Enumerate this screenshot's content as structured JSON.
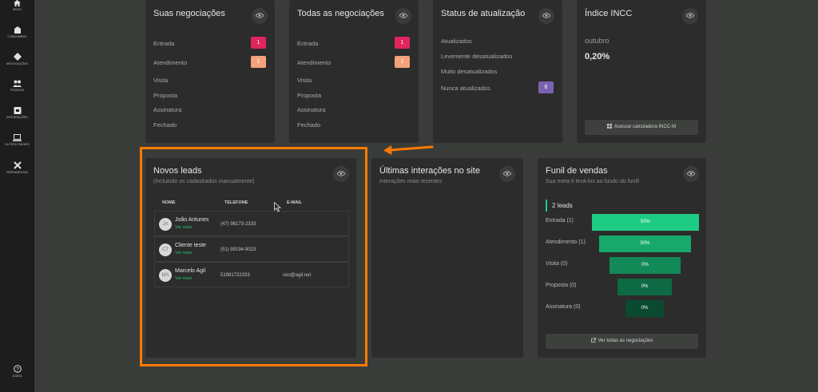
{
  "sidebar": {
    "items": [
      {
        "label": "Início",
        "icon": "home-icon"
      },
      {
        "label": "Condomínio",
        "icon": "building-icon"
      },
      {
        "label": "Negociações",
        "icon": "handshake-icon"
      },
      {
        "label": "Pessoas",
        "icon": "people-icon"
      },
      {
        "label": "Integrações",
        "icon": "integration-icon"
      },
      {
        "label": "Outros painéis",
        "icon": "laptop-icon"
      },
      {
        "label": "Ferramentas",
        "icon": "tools-icon"
      }
    ],
    "help_label": "Ajuda"
  },
  "suas_negociacoes": {
    "title": "Suas negociações",
    "rows": [
      {
        "label": "Entrada",
        "count": "1"
      },
      {
        "label": "Atendimento",
        "count": "1"
      },
      {
        "label": "Visita"
      },
      {
        "label": "Proposta"
      },
      {
        "label": "Assinatura"
      },
      {
        "label": "Fechado"
      }
    ]
  },
  "todas_negociacoes": {
    "title": "Todas as negociações",
    "rows": [
      {
        "label": "Entrada",
        "count": "1"
      },
      {
        "label": "Atendimento",
        "count": "1"
      },
      {
        "label": "Visita"
      },
      {
        "label": "Proposta"
      },
      {
        "label": "Assinatura"
      },
      {
        "label": "Fechado"
      }
    ]
  },
  "status": {
    "title": "Status de atualização",
    "rows": [
      {
        "label": "Atualizados"
      },
      {
        "label": "Levemente desatualizados"
      },
      {
        "label": "Muito desatualizados"
      },
      {
        "label": "Nunca atualizados",
        "count": "6"
      }
    ]
  },
  "incc": {
    "title": "Índice INCC",
    "month": "outubro",
    "value": "0,20%",
    "button": "Acessar calculadora INCC-M"
  },
  "leads": {
    "title": "Novos leads",
    "subtitle": "(Incluindo os cadastrados manualmente)",
    "headers": {
      "name": "NOME",
      "phone": "TELEFONE",
      "email": "E-MAIL"
    },
    "rows": [
      {
        "initials": "JA",
        "name": "João Antunes",
        "more": "Ver mais",
        "phone": "(47) 98173-2333",
        "email": ""
      },
      {
        "initials": "CT",
        "name": "Cliente teste",
        "more": "Ver mais",
        "phone": "(51) 99194-9023",
        "email": ""
      },
      {
        "initials": "MA",
        "name": "Marcelo Agil",
        "more": "Ver mais",
        "phone": "51981732333",
        "email": "ceo@agil.net"
      }
    ]
  },
  "interacoes": {
    "title": "Últimas interações no site",
    "subtitle": "Interações mais recentes"
  },
  "funil": {
    "title": "Funil de vendas",
    "subtitle": "Sua meta é levá-los ao fundo do funil!",
    "total": "2 leads",
    "stages": [
      {
        "label": "Entrada (1)",
        "value": "50%",
        "fraction": 0.5
      },
      {
        "label": "Atendimento (1)",
        "value": "50%",
        "fraction": 0.5
      },
      {
        "label": "Visita (0)",
        "value": "0%",
        "fraction": 0
      },
      {
        "label": "Proposta (0)",
        "value": "0%",
        "fraction": 0
      },
      {
        "label": "Assinatura (0)",
        "value": "0%",
        "fraction": 0
      }
    ],
    "button": "Ver todas as negociações"
  },
  "colors": {
    "badge_red": "#e0245e",
    "badge_orange": "#f4a27c",
    "badge_purple": "#7b62b0",
    "funnel": [
      "#1ecb85",
      "#17a86c",
      "#128a58",
      "#0d6a44",
      "#094a30"
    ],
    "highlight": "#ff7a00"
  }
}
